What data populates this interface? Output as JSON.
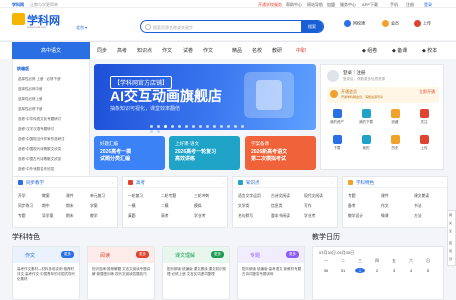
{
  "topbar": {
    "brand": "学科网",
    "slogan": "让教与学更简单",
    "links": [
      "开通学校服务",
      "帮助中心",
      "网站导航",
      "加盟",
      "服务中心",
      "APP下载",
      "手机",
      "注册",
      "登录"
    ]
  },
  "header": {
    "logo_text": "学科网",
    "logo_url": "www.zxxk.com",
    "region": "北京",
    "search_placeholder": "搜索资源名称或关键字",
    "search_button": "搜索",
    "icons": [
      {
        "label": "网校通",
        "icon": "school-icon",
        "color": "#2b6fe5"
      },
      {
        "label": "会员",
        "icon": "vip-icon",
        "color": "#f0a22b"
      },
      {
        "label": "上传",
        "icon": "upload-icon",
        "color": "#e0432f"
      }
    ]
  },
  "nav": {
    "category_label": "高中语文",
    "items": [
      "同步",
      "高考",
      "知识点",
      "作文",
      "试卷",
      "作文",
      "精品",
      "名校",
      "教研",
      "中职"
    ],
    "right_items": [
      "组卷",
      "备课",
      "校本"
    ]
  },
  "sidebar": {
    "heading": "统编版",
    "items": [
      "选择性必修 上册 · 必修下册",
      "选择性必修中册",
      "选择性必修上册",
      "选择性必修下册",
      "选修·中华传统文化专题研讨",
      "选修·汉字汉语专题研讨",
      "选修·中国现当代作家作品研讨",
      "选修·中国现代诗歌散文欣赏",
      "选修·中国古代诗歌散文欣赏",
      "选修·中外戏剧名作欣赏"
    ]
  },
  "banner": {
    "tag": "【学科网官方店铺】",
    "title": "AI交互动画旗舰店",
    "subtitle": "抽象知识可视化，课堂效率翻倍",
    "slides": 16,
    "active_slide": 2
  },
  "promo_cards": [
    {
      "l1": "好题汇编",
      "l2": "2026高考一模",
      "l3": "试题分类汇编",
      "color": "#3b82f6"
    },
    {
      "l1": "上好课·语文",
      "l2": "2026高考一轮复习",
      "l3": "高效讲练",
      "color": "#1fa4c8"
    },
    {
      "l1": "学案备课",
      "l2": "2026新高考语文",
      "l3": "第二次模拟考试",
      "color": "#f0633a"
    }
  ],
  "user_panel": {
    "login": "登录｜注册",
    "hint": "登录后，获取更多优质资源",
    "vip_title": "开通会员",
    "vip_desc": "开通学科网会员，海量资源尽享",
    "vip_button": "立即开通",
    "grid": [
      {
        "label": "我的资产",
        "color": "#2b6fe5"
      },
      {
        "label": "我的下载",
        "color": "#1fa4c8"
      },
      {
        "label": "收藏",
        "color": "#f0a22b"
      },
      {
        "label": "关注",
        "color": "#e0432f"
      },
      {
        "label": "下载",
        "color": "#2b6fe5"
      },
      {
        "label": "我的",
        "color": "#1fa4c8"
      },
      {
        "label": "历史",
        "color": "#f0a22b"
      },
      {
        "label": "上传",
        "color": "#e0432f"
      }
    ]
  },
  "sections": [
    {
      "title": "同步教学",
      "cells": [
        "开学",
        "教案",
        "课件",
        "单元复习",
        "同步练习",
        "期中",
        "期末",
        "学案",
        "专题",
        "导学案",
        "期末",
        "教学"
      ]
    },
    {
      "title": "高考",
      "cells": [
        "一轮复习",
        "二轮专题",
        "三轮冲刺",
        "一模",
        "二模",
        "模拟",
        "真题",
        "高考",
        "学业考"
      ]
    },
    {
      "title": "知识点",
      "cells": [
        "语言文字运用",
        "古诗文阅读",
        "现代文阅读",
        "文学类",
        "信息类",
        "写作",
        "名句默写",
        "整本书阅读",
        "学业考"
      ]
    },
    {
      "title": "学科特色",
      "cells": [
        "专题",
        "课件",
        "课文朗读",
        "备考",
        "作文",
        "书法",
        "教学设计",
        "微课",
        "方法"
      ]
    }
  ],
  "features": {
    "title": "学科特色",
    "cards": [
      {
        "name": "作文",
        "badge": "更多",
        "color": "#2b6fe5",
        "bg": "#eaf2ff",
        "text": "高考作文素材—材料多用实例·推荐时评文 高考作文·中国青年的中国式现代化素材"
      },
      {
        "name": "阅读",
        "badge": "更多",
        "color": "#e0432f",
        "bg": "#fdecea",
        "text": "知识选串·推荐解题 文言文阅读专题讲解·新题型训练 现代文阅读答题技巧"
      },
      {
        "name": "课文理解",
        "badge": "更多",
        "color": "#1f9d55",
        "bg": "#e7f7ee",
        "text": "配乐朗读·统编版 课文朗读 课文知识梳理·必修上册 文言实词虚词整理"
      },
      {
        "name": "专题",
        "badge": "更多",
        "color": "#8b5cf6",
        "bg": "#f1ecfe",
        "text": "配乐朗读 统编版·高考语文 新教材专题 古诗词鉴赏专题训练"
      }
    ]
  },
  "calendar": {
    "title": "教学日历",
    "range": "03月30日-04月05日",
    "days": [
      "一",
      "二",
      "三",
      "四",
      "五",
      "六",
      "日"
    ],
    "dates": [
      "30",
      "31",
      "1",
      "2",
      "3",
      "4",
      "5"
    ],
    "active_index": 2
  },
  "float_bar": [
    "网",
    "关",
    "注",
    "回",
    "到",
    "顶"
  ]
}
